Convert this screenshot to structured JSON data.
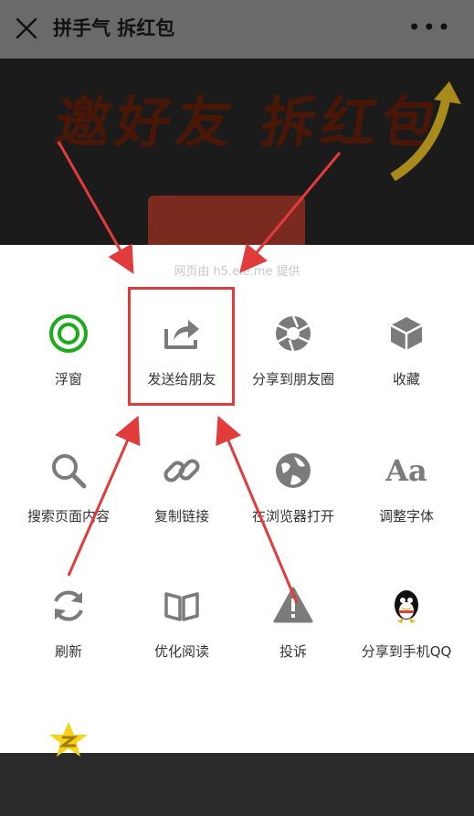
{
  "header": {
    "title": "拼手气 拆红包",
    "more": "•••"
  },
  "banner": {
    "headline": "邀好友 拆红包"
  },
  "sheet": {
    "provider": "网页由 h5.ele.me 提供",
    "tiles": [
      {
        "label": "浮窗",
        "icon": "floating-window-icon"
      },
      {
        "label": "发送给朋友",
        "icon": "share-forward-icon"
      },
      {
        "label": "分享到朋友圈",
        "icon": "moments-shutter-icon"
      },
      {
        "label": "收藏",
        "icon": "favorite-cube-icon"
      },
      {
        "label": "搜索页面内容",
        "icon": "search-icon"
      },
      {
        "label": "复制链接",
        "icon": "link-icon"
      },
      {
        "label": "在浏览器打开",
        "icon": "globe-icon"
      },
      {
        "label": "调整字体",
        "icon": "font-aa-icon"
      },
      {
        "label": "刷新",
        "icon": "refresh-icon"
      },
      {
        "label": "优化阅读",
        "icon": "book-icon"
      },
      {
        "label": "投诉",
        "icon": "warning-icon"
      },
      {
        "label": "分享到手机QQ",
        "icon": "qq-penguin-icon"
      },
      {
        "label": "",
        "icon": "qzone-star-icon"
      }
    ]
  },
  "colors": {
    "highlight": "#e23b3b",
    "green": "#1aad19",
    "icon_gray": "#7b7b7b"
  }
}
